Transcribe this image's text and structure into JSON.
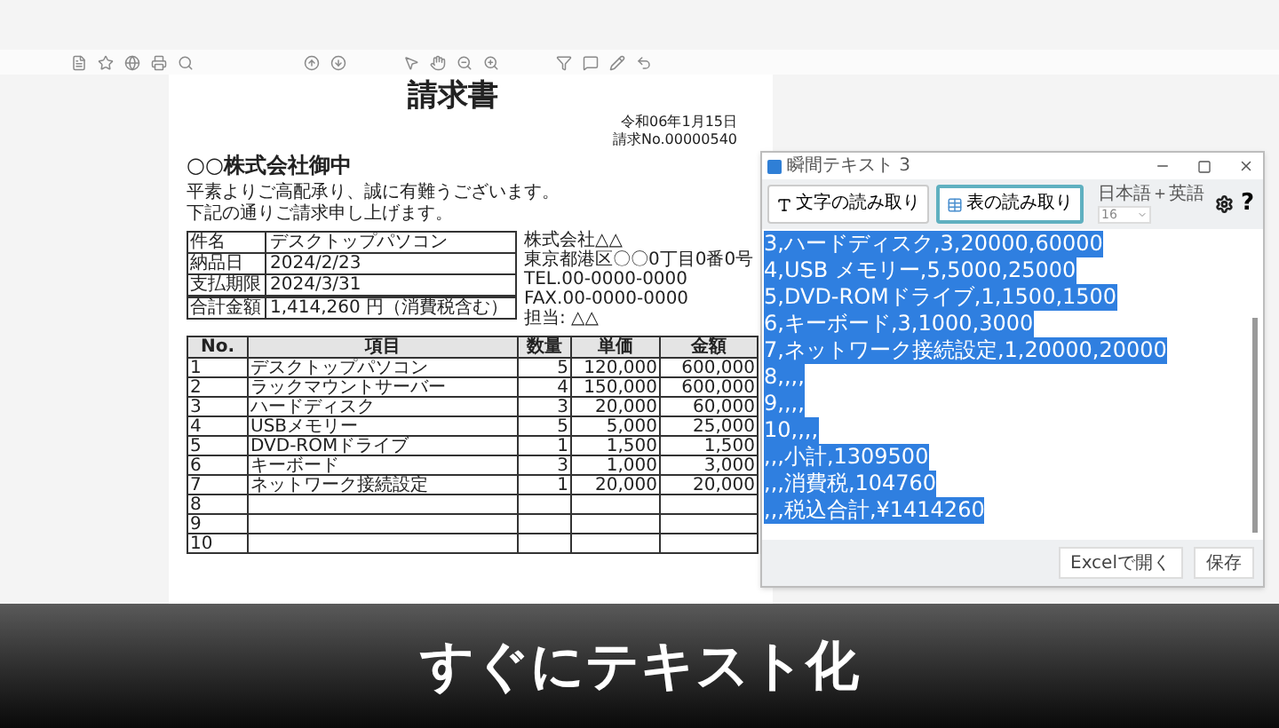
{
  "document": {
    "title": "請求書",
    "date": "令和06年1月15日",
    "invoice_no": "請求No.00000540",
    "addressee": "○○株式会社御中",
    "greeting": [
      "平素よりご高配承り、誠に有難うございます。",
      "下記の通りご請求申し上げます。"
    ],
    "issuer": [
      "株式会社△△",
      "東京都港区〇〇0丁目0番0号",
      "TEL.00-0000-0000",
      "FAX.00-0000-0000",
      "担当: △△"
    ],
    "summary": [
      {
        "label": "件名",
        "value": "デスクトップパソコン"
      },
      {
        "label": "納品日",
        "value": "2024/2/23"
      },
      {
        "label": "支払期限",
        "value": "2024/3/31"
      },
      {
        "label": "合計金額",
        "value": "1,414,260 円（消費税含む）"
      }
    ],
    "items": {
      "columns": [
        "No.",
        "項目",
        "数量",
        "単価",
        "金額"
      ],
      "rows": [
        {
          "no": "1",
          "item": "デスクトップパソコン",
          "qty": "5",
          "unit_price": "120,000",
          "amount": "600,000"
        },
        {
          "no": "2",
          "item": "ラックマウントサーバー",
          "qty": "4",
          "unit_price": "150,000",
          "amount": "600,000"
        },
        {
          "no": "3",
          "item": "ハードディスク",
          "qty": "3",
          "unit_price": "20,000",
          "amount": "60,000"
        },
        {
          "no": "4",
          "item": "USBメモリー",
          "qty": "5",
          "unit_price": "5,000",
          "amount": "25,000"
        },
        {
          "no": "5",
          "item": "DVD-ROMドライブ",
          "qty": "1",
          "unit_price": "1,500",
          "amount": "1,500"
        },
        {
          "no": "6",
          "item": "キーボード",
          "qty": "3",
          "unit_price": "1,000",
          "amount": "3,000"
        },
        {
          "no": "7",
          "item": "ネットワーク接続設定",
          "qty": "1",
          "unit_price": "20,000",
          "amount": "20,000"
        },
        {
          "no": "8"
        },
        {
          "no": "9"
        },
        {
          "no": "10"
        }
      ]
    }
  },
  "app_window": {
    "title": "瞬間テキスト 3",
    "modes": [
      {
        "label": "文字の読み取り",
        "selected": false
      },
      {
        "label": "表の読み取り",
        "selected": true
      }
    ],
    "language": "日本語＋英語",
    "font_size": "16",
    "help_label": "?",
    "text_area": {
      "selected": true,
      "lines": [
        "3,ハードディスク,3,20000,60000",
        "4,USB メモリー,5,5000,25000",
        "5,DVD-ROMドライブ,1,1500,1500",
        "6,キーボード,3,1000,3000",
        "7,ネットワーク接続設定,1,20000,20000",
        "8,,,,",
        "9,,,,",
        "10,,,,",
        ",,,小計,1309500",
        ",,,消費税,104760",
        ",,,税込合計,¥1414260"
      ]
    },
    "footer_buttons": [
      "Excelで開く",
      "保存"
    ]
  },
  "caption": "すぐにテキスト化"
}
